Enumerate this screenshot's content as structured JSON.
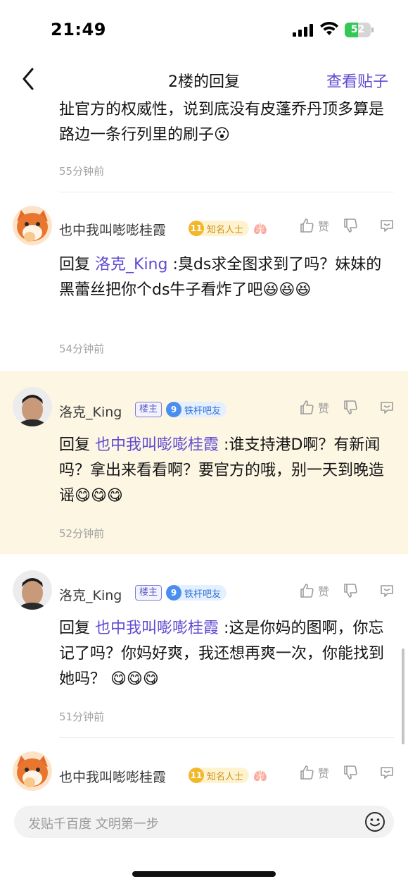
{
  "status_bar": {
    "time": "21:49",
    "battery": "52",
    "battery_level": 0.52
  },
  "nav": {
    "back_icon": "chevron-left-icon",
    "title": "2楼的回复",
    "action": "查看贴子"
  },
  "partial_comment": {
    "text": "扯官方的权威性，说到底没有皮蓬乔丹顶多算是路边一条行列里的刷子😮",
    "time": "55分钟前"
  },
  "comments": [
    {
      "username": "也中我叫嘭嘭桂霞",
      "is_op": false,
      "level": "11",
      "level_name": "知名人士",
      "extra_icon": "lungs-icon",
      "like_label": "赞",
      "reply_prefix": "回复",
      "reply_target": "洛克_King",
      "text": ":臭ds求全图求到了吗？妹妹的黑蕾丝把你个ds牛子看炸了吧",
      "emojis": "😆😆😆",
      "time": "54分钟前"
    },
    {
      "username": "洛克_King",
      "is_op": true,
      "op_label": "楼主",
      "level": "9",
      "level_name": "铁杆吧友",
      "like_label": "赞",
      "reply_prefix": "回复",
      "reply_target": "也中我叫嘭嘭桂霞",
      "text": ":谁支持港D啊？有新闻吗？拿出来看看啊？要官方的哦，别一天到晚造谣",
      "emojis": "😋😋😋",
      "time": "52分钟前"
    },
    {
      "username": "洛克_King",
      "is_op": true,
      "op_label": "楼主",
      "level": "9",
      "level_name": "铁杆吧友",
      "like_label": "赞",
      "reply_prefix": "回复",
      "reply_target": "也中我叫嘭嘭桂霞",
      "text": ":这是你妈的图啊，你忘记了吗？你妈好爽，我还想再爽一次，你能找到她吗？ ",
      "emojis": "😋😋😋",
      "time": "51分钟前"
    },
    {
      "username": "也中我叫嘭嘭桂霞",
      "is_op": false,
      "level": "11",
      "level_name": "知名人士",
      "extra_icon": "lungs-icon",
      "like_label": "赞"
    }
  ],
  "input": {
    "placeholder": "发贴千百度 文明第一步",
    "emoji_icon": "smiley-icon"
  },
  "colors": {
    "accent": "#5f4bd1",
    "highlight_bg": "#fcf6e3",
    "meta_gray": "#a3a3a3"
  }
}
